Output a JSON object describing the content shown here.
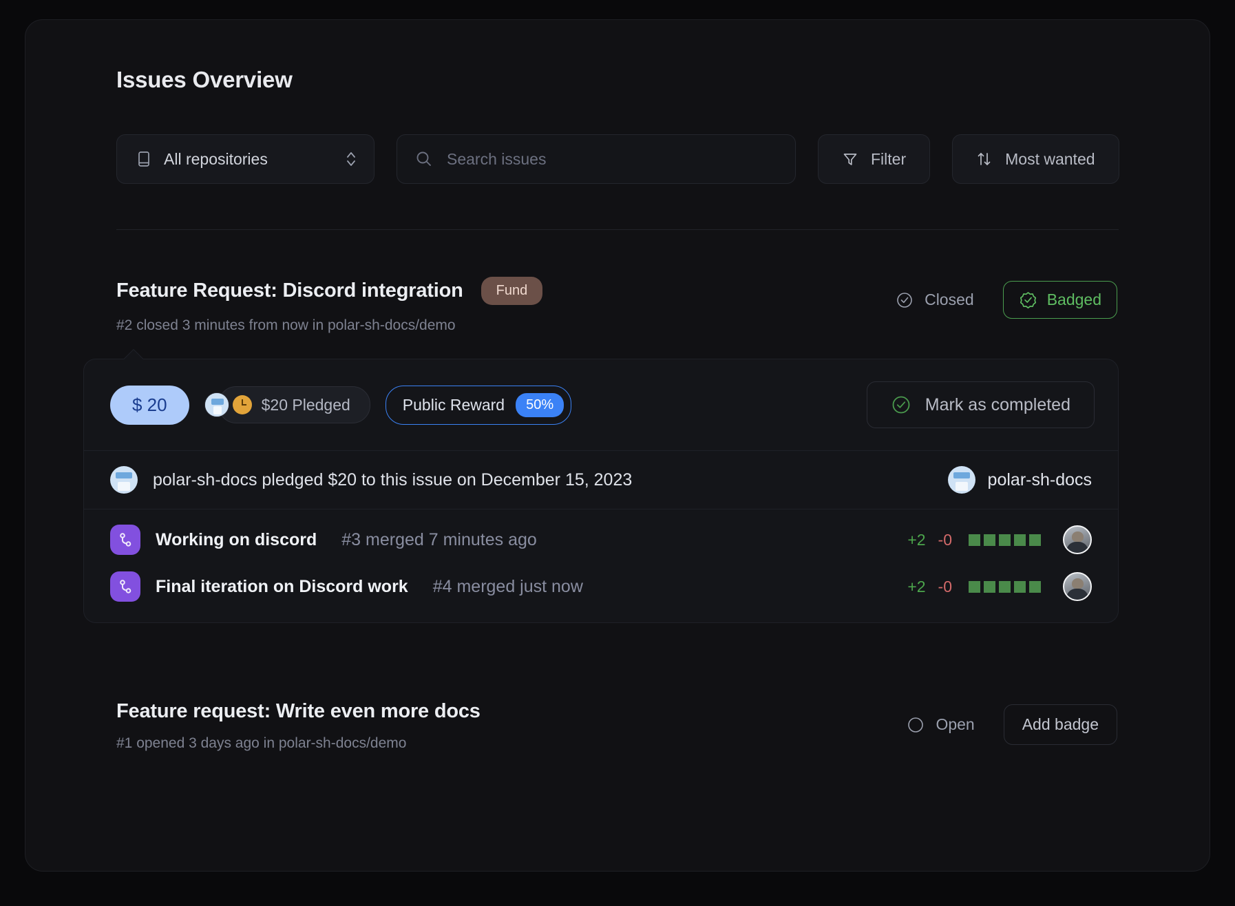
{
  "header": {
    "title": "Issues Overview"
  },
  "toolbar": {
    "repo_selector": {
      "label": "All repositories",
      "icon": "repo-icon",
      "chevron": "chevron-up-down-icon"
    },
    "search": {
      "placeholder": "Search issues",
      "value": "",
      "icon": "search-icon"
    },
    "filter": {
      "label": "Filter",
      "icon": "funnel-icon"
    },
    "sort": {
      "label": "Most wanted",
      "icon": "sort-arrows-icon"
    }
  },
  "issues": [
    {
      "title": "Feature Request: Discord integration",
      "fund_label": "Fund",
      "meta": "#2 closed 3 minutes from now in polar-sh-docs/demo",
      "status_label": "Closed",
      "status_icon": "check-circle-icon",
      "action_label": "Badged",
      "action_icon": "verified-badge-icon",
      "pledge": {
        "amount": "$ 20",
        "pledged_label": "$20 Pledged",
        "pledged_icon": "clock-icon",
        "reward_label": "Public Reward",
        "reward_pct": "50%",
        "mark_label": "Mark as completed",
        "mark_icon": "check-circle-icon"
      },
      "activity": {
        "text": "polar-sh-docs pledged $20 to this issue on December 15, 2023",
        "org": "polar-sh-docs"
      },
      "pulls": [
        {
          "icon": "git-pull-request-icon",
          "title": "Working on discord",
          "meta": "#3 merged 7 minutes ago",
          "additions": "+2",
          "deletions": "-0",
          "blocks": 5,
          "avatar": "user-avatar"
        },
        {
          "icon": "git-pull-request-icon",
          "title": "Final iteration on Discord work",
          "meta": "#4 merged just now",
          "additions": "+2",
          "deletions": "-0",
          "blocks": 5,
          "avatar": "user-avatar"
        }
      ]
    },
    {
      "title": "Feature request: Write even more docs",
      "meta": "#1 opened 3 days ago in polar-sh-docs/demo",
      "status_label": "Open",
      "status_icon": "circle-icon",
      "action_label": "Add badge"
    }
  ],
  "colors": {
    "page_bg": "#09090b",
    "card_bg": "#111114",
    "accent_blue": "#3b82f6",
    "amount_pill": "#aecbfa",
    "badged_green": "#5fbd62",
    "fund_brown": "#6b5048",
    "pr_purple": "#8250df",
    "addition_green": "#4ca64c",
    "deletion_red": "#d46a6a"
  }
}
